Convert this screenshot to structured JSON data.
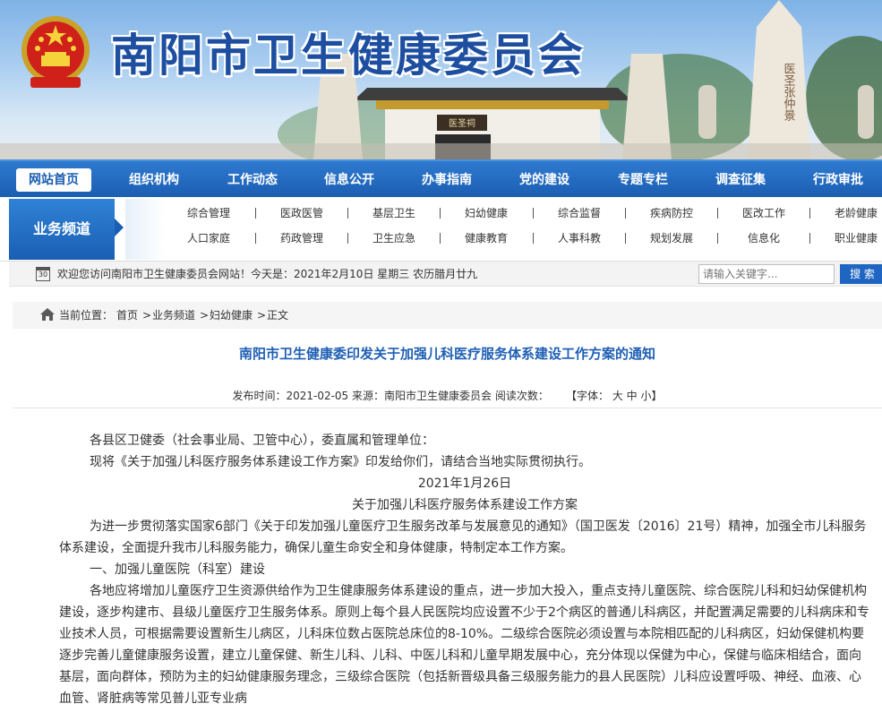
{
  "header": {
    "site_title": "南阳市卫生健康委员会",
    "monument_text": "医圣张仲景",
    "gate_plaque": "医圣祠"
  },
  "nav": {
    "items": [
      "网站首页",
      "组织机构",
      "工作动态",
      "信息公开",
      "办事指南",
      "党的建设",
      "专题专栏",
      "调查征集",
      "行政审批"
    ],
    "active": "网站首页"
  },
  "channel": {
    "label": "业务频道",
    "row1": [
      "综合管理",
      "医政医管",
      "基层卫生",
      "妇幼健康",
      "综合监督",
      "疾病防控",
      "医改工作",
      "老龄健康"
    ],
    "row2": [
      "人口家庭",
      "药政管理",
      "卫生应急",
      "健康教育",
      "人事科教",
      "规划发展",
      "信息化",
      "职业健康"
    ]
  },
  "infobar": {
    "calendar_day": "30",
    "welcome": "欢迎您访问南阳市卫生健康委员会网站！今天是：2021年2月10日 星期三 农历腊月廿九",
    "search_placeholder": "请输入关键字...",
    "search_button": "搜 索"
  },
  "breadcrumb": {
    "prefix": "当前位置：",
    "items": [
      "首页",
      "业务频道",
      "妇幼健康",
      "正文"
    ],
    "separator": ">"
  },
  "article": {
    "title": "南阳市卫生健康委印发关于加强儿科医疗服务体系建设工作方案的通知",
    "meta": {
      "publish_label": "发布时间：",
      "publish_date": "2021-02-05",
      "source_label": "来源：",
      "source": "南阳市卫生健康委员会",
      "views_label": "阅读次数：",
      "font_label": "【字体：",
      "font_sizes": [
        "大",
        "中",
        "小"
      ],
      "font_end": "】"
    },
    "paragraphs": [
      {
        "text": "各县区卫健委（社会事业局、卫管中心），委直属和管理单位：",
        "align": "indent"
      },
      {
        "text": "现将《关于加强儿科医疗服务体系建设工作方案》印发给你们，请结合当地实际贯彻执行。",
        "align": "indent"
      },
      {
        "text": "2021年1月26日",
        "align": "center"
      },
      {
        "text": "关于加强儿科医疗服务体系建设工作方案",
        "align": "center"
      },
      {
        "text": "为进一步贯彻落实国家6部门《关于印发加强儿童医疗卫生服务改革与发展意见的通知》（国卫医发〔2016〕21号）精神，加强全市儿科服务体系建设，全面提升我市儿科服务能力，确保儿童生命安全和身体健康，特制定本工作方案。",
        "align": "indent"
      },
      {
        "text": "一、加强儿童医院（科室）建设",
        "align": "indent"
      },
      {
        "text": "各地应将增加儿童医疗卫生资源供给作为卫生健康服务体系建设的重点，进一步加大投入，重点支持儿童医院、综合医院儿科和妇幼保健机构建设，逐步构建市、县级儿童医疗卫生服务体系。原则上每个县人民医院均应设置不少于2个病区的普通儿科病区，并配置满足需要的儿科病床和专业技术人员，可根据需要设置新生儿病区，儿科床位数占医院总床位的8-10%。二级综合医院必须设置与本院相匹配的儿科病区，妇幼保健机构要逐步完善儿童健康服务设置，建立儿童保健、新生儿科、儿科、中医儿科和儿童早期发展中心，充分体现以保健为中心，保健与临床相结合，面向基层，面向群体，预防为主的妇幼健康服务理念，三级综合医院（包括新晋级具备三级服务能力的县人民医院）儿科应设置呼吸、神经、血液、心血管、肾脏病等常见普儿亚专业病",
        "align": "indent"
      }
    ]
  }
}
